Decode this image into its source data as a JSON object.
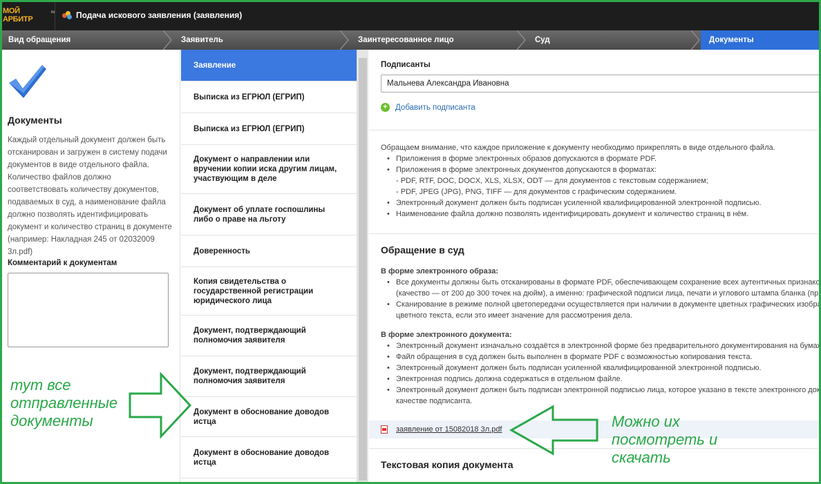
{
  "app": {
    "logo_text": "МОЙ АРБИТР",
    "logo_sup": "ru",
    "title": "Подача искового заявления (заявления)"
  },
  "steps": [
    {
      "label": "Вид обращения",
      "active": false
    },
    {
      "label": "Заявитель",
      "active": false
    },
    {
      "label": "Заинтересованное лицо",
      "active": false
    },
    {
      "label": "Суд",
      "active": false
    },
    {
      "label": "Документы",
      "active": true
    }
  ],
  "left_panel": {
    "title": "Документы",
    "description": "Каждый отдельный документ должен быть отсканирован и загружен в систему подачи документов в виде отдельного файла. Количество файлов должно соответствовать количеству документов, подаваемых в суд, а наименование файла должно позволять идентифицировать документ и количество страниц в документе (например: Накладная 245 от 02032009 3л.pdf)",
    "comment_label": "Комментарий к документам",
    "comment_value": ""
  },
  "documents": [
    {
      "label": "Заявление",
      "active": true
    },
    {
      "label": "Выписка из ЕГРЮЛ (ЕГРИП)",
      "active": false
    },
    {
      "label": "Выписка из ЕГРЮЛ (ЕГРИП)",
      "active": false
    },
    {
      "label": "Документ о направлении или вручении копии иска другим лицам, участвующим в деле",
      "active": false
    },
    {
      "label": "Документ об уплате госпошлины либо о праве на льготу",
      "active": false
    },
    {
      "label": "Доверенность",
      "active": false
    },
    {
      "label": "Копия свидетельства о государственной регистрации юридического лица",
      "active": false
    },
    {
      "label": "Документ, подтверждающий полномочия заявителя",
      "active": false
    },
    {
      "label": "Документ, подтверждающий полномочия заявителя",
      "active": false
    },
    {
      "label": "Документ в обоснование доводов истца",
      "active": false
    },
    {
      "label": "Документ в обоснование доводов истца",
      "active": false
    }
  ],
  "signers": {
    "label": "Подписанты",
    "value": "Мальнева Александра Ивановна",
    "add_label": "Добавить подписанта"
  },
  "notice": {
    "intro": "Обращаем внимание, что каждое приложение к документу необходимо прикреплять в виде отдельного файла.",
    "b1": "Приложения в форме электронных образов допускаются в формате PDF.",
    "b2": "Приложения в форме электронных документов допускаются в форматах:",
    "b2_sub1": "- PDF, RTF, DOC, DOCX, XLS, XLSX, ODT — для документов с текстовым содержанием;",
    "b2_sub2": "- PDF, JPEG (JPG), PNG, TIFF — для документов с графическим содержанием.",
    "b3": "Электронный документ должен быть подписан усиленной квалифицированной электронной подписью.",
    "b4": "Наименование файла должно позволять идентифицировать документ и количество страниц в нём."
  },
  "court": {
    "title": "Обращение в суд",
    "image_heading": "В форме электронного образа:",
    "img_b1_l1": "Все документы должны быть отсканированы в формате PDF, обеспечивающем сохранение всех аутентичных признаков",
    "img_b1_l2": "(качество — от 200 до 300 точек на дюйм), а именно: графической подписи лица, печати и углового штампа бланка (при",
    "img_b2_l1": "Сканирование в режиме полной цветопередачи осуществляется при наличии в документе цветных графических изображ",
    "img_b2_l2": "цветного текста, если это имеет значение для рассмотрения дела.",
    "doc_heading": "В форме электронного документа:",
    "doc_b1": "Электронный документ изначально создаётся в электронной форме без предварительного документирования на бумажн",
    "doc_b2": "Файл обращения в суд должен быть выполнен в формате PDF с возможностью копирования текста.",
    "doc_b3": "Электронный документ должен быть подписан усиленной квалифицированной электронной подписью.",
    "doc_b4": "Электронная подпись должна содержаться в отдельном файле.",
    "doc_b5_l1": "Электронный документ должен быть подписан электронной подписью лица, которое указано в тексте электронного доку",
    "doc_b5_l2": "качестве подписанта."
  },
  "file": {
    "name": "заявление от 15082018 3л.pdf"
  },
  "text_copy": {
    "title": "Текстовая копия документа"
  },
  "annotations": {
    "left_l1": "тут все",
    "left_l2": "отправленные",
    "left_l3": "документы",
    "right_l1": "Можно их",
    "right_l2": "посмотреть и",
    "right_l3": "скачать",
    "color": "#2aa84a"
  },
  "colors": {
    "accent": "#3b78e0",
    "topbar": "#1d1d1d",
    "link": "#2c6db3",
    "annotation": "#2aa84a"
  }
}
